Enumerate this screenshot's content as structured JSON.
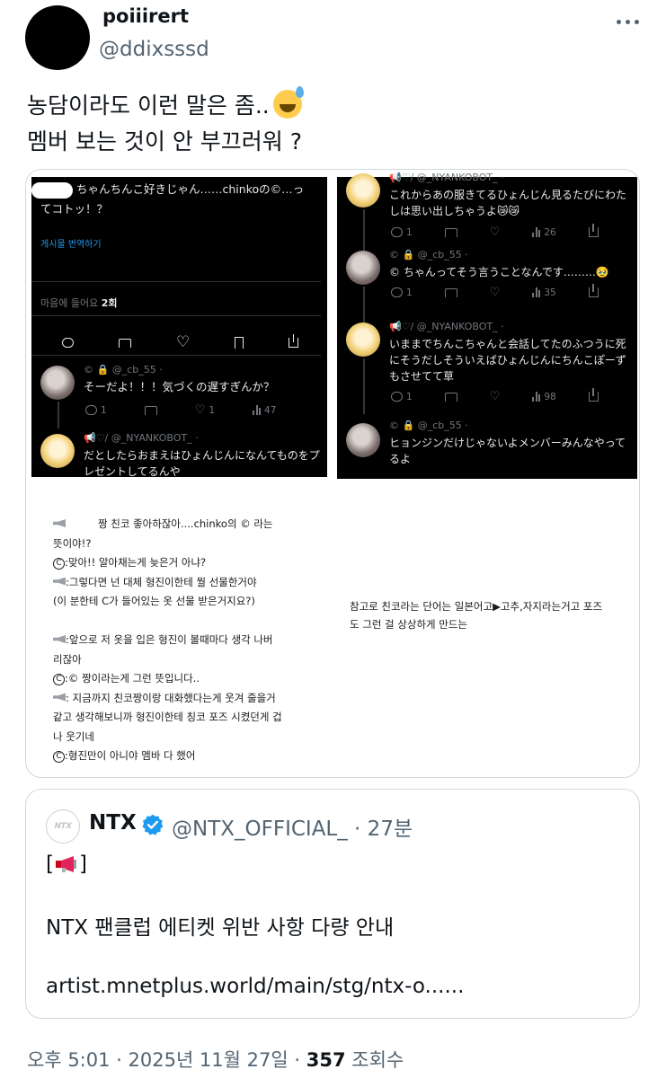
{
  "author": {
    "display_name": "poiiirert",
    "handle": "@ddixsssd"
  },
  "tweet": {
    "line1": "농담이라도 이런 말은 좀..",
    "emoji": "sweat-smile-emoji",
    "line2": "멤버 보는 것이 안 부끄러워 ?"
  },
  "media": {
    "left": {
      "top_text_1": "ちゃんちんこ好きじゃん……chinkoの©…っ",
      "top_text_2": "てコトッ！？",
      "translate_link": "게시물 번역하기",
      "likes_label": "마음에 들어요",
      "likes_count": "2회",
      "reply1": {
        "handle": "©  🔒 @_cb_55 ·",
        "text": "そーだよ！！！気づくの遅すぎんか？",
        "replies": "1",
        "likes": "1",
        "views": "47"
      },
      "reply2": {
        "handle": "📢♡/ @_NYANKOBOT_ ·",
        "text_1": "だとしたらおまえはひょんじんになんてものをプ",
        "text_2": "レゼントしてるんや"
      }
    },
    "right": {
      "post1": {
        "handle": "📢♡/ @_NYANKOBOT_ ·",
        "text_1": "これからあの服きてるひょんじん見るたびにわた",
        "text_2": "しは思い出しちゃうよ😿😿",
        "replies": "1",
        "views": "26"
      },
      "post2": {
        "handle": "©  🔒 @_cb_55 ·",
        "text": "© ちゃんってそう言うことなんです………🥹",
        "replies": "1",
        "views": "35"
      },
      "post3": {
        "handle": "📢♡/ @_NYANKOBOT_ ·",
        "text_1": "いままでちんこちゃんと会話してたのふつうに死",
        "text_2": "にそうだしそういえばひょんじんにちんこぽーず",
        "text_3": "もさせてて草",
        "replies": "1",
        "views": "98"
      },
      "post4": {
        "handle": "©  🔒 @_cb_55 ·",
        "text_1": "ヒョンジンだけじゃないよメンバーみんなやって",
        "text_2": "るよ"
      }
    },
    "translation": {
      "l1": "짱 친코 좋아하잖아....chinko의 © 라는",
      "l2": "뜻이야!?",
      "l3": ":맞아!! 알아채는게 늦은거 아냐?",
      "l4": ":그렇다면 넌 대체 형진이한테 뭘 선물한거야",
      "l5": "(이 분한테 C가 들어있는 옷 선물 받은거지요?)",
      "l6": ":앞으로 저 옷을 입은 형진이 볼때마다 생각 나버",
      "l7": "리잖아",
      "l8": ":© 짱이라는게 그런 뜻입니다..",
      "l9": ": 지금까지 친코짱이랑 대화했다는게 웃겨 줄을거",
      "l10": "같고 생각해보니까 형진이한테 칭코 포즈 시켰던게 겁",
      "l11": "나 웃기네",
      "l12": ":형진만이 아니야 멤바 다 했어"
    },
    "note": {
      "l1": "참고로 친코라는 단어는 일본어고▶고추,자지라는거고 포즈",
      "l2": "도 그런 걸 상상하게 만드는"
    }
  },
  "quote": {
    "avatar_text": "NTX",
    "name": "NTX",
    "handle_time": "@NTX_OFFICIAL_ · 27분",
    "tag_open": "[",
    "tag_close": "]",
    "line1": "NTX 팬클럽 에티켓 위반 사항 다량 안내",
    "line2": "artist.mnetplus.world/main/stg/ntx-o......"
  },
  "footer": {
    "time": "오후 5:01 · 2025년 11월 27일 · ",
    "views_count": "357",
    "views_label": " 조회수"
  },
  "colors": {
    "verified": "#1d9bf0",
    "secondary_text": "#536471",
    "border": "#cfd9de"
  }
}
